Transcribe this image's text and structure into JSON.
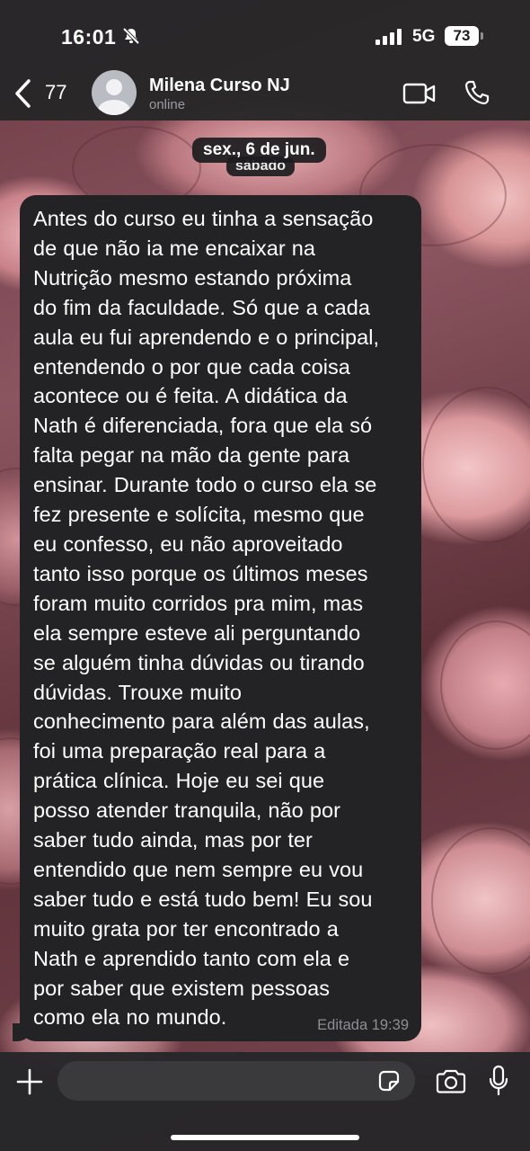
{
  "status_bar": {
    "time": "16:01",
    "network": "5G",
    "battery": "73"
  },
  "header": {
    "back_count": "77",
    "contact_name": "Milena Curso NJ",
    "contact_status": "online"
  },
  "chat": {
    "date_label": "sex., 6 de jun.",
    "date_label_behind": "sábado",
    "message": {
      "lines": [
        "Antes do curso eu tinha a sensação",
        "de que não ia me encaixar na",
        "Nutrição mesmo estando próxima",
        "do fim da faculdade. Só que a cada",
        "aula eu fui aprendendo e o principal,",
        "entendendo o por que cada coisa",
        "acontece ou é feita. A didática da",
        "Nath é diferenciada, fora que ela só",
        "falta pegar na mão da gente para",
        "ensinar. Durante todo o curso ela se",
        "fez presente e solícita, mesmo que",
        "eu confesso, eu não aproveitado",
        "tanto isso porque os últimos meses",
        "foram muito corridos pra mim, mas",
        "ela sempre esteve ali perguntando",
        "se alguém tinha dúvidas ou tirando",
        "dúvidas. Trouxe muito",
        "conhecimento para além das aulas,",
        "foi uma preparação real para a",
        "prática clínica. Hoje eu sei que",
        "posso atender tranquila, não por",
        "saber tudo ainda, mas por ter",
        "entendido que nem sempre eu vou",
        "saber tudo e está tudo bem! Eu sou",
        "muito grata por ter encontrado a",
        "Nath e aprendido tanto com ela e",
        "por saber que existem pessoas",
        "como ela no mundo."
      ],
      "meta": "Editada 19:39"
    }
  },
  "input_bar": {
    "placeholder": ""
  },
  "colors": {
    "header_bg": "#262628",
    "bubble_bg": "#232325",
    "meta_text": "#8e8e93"
  }
}
